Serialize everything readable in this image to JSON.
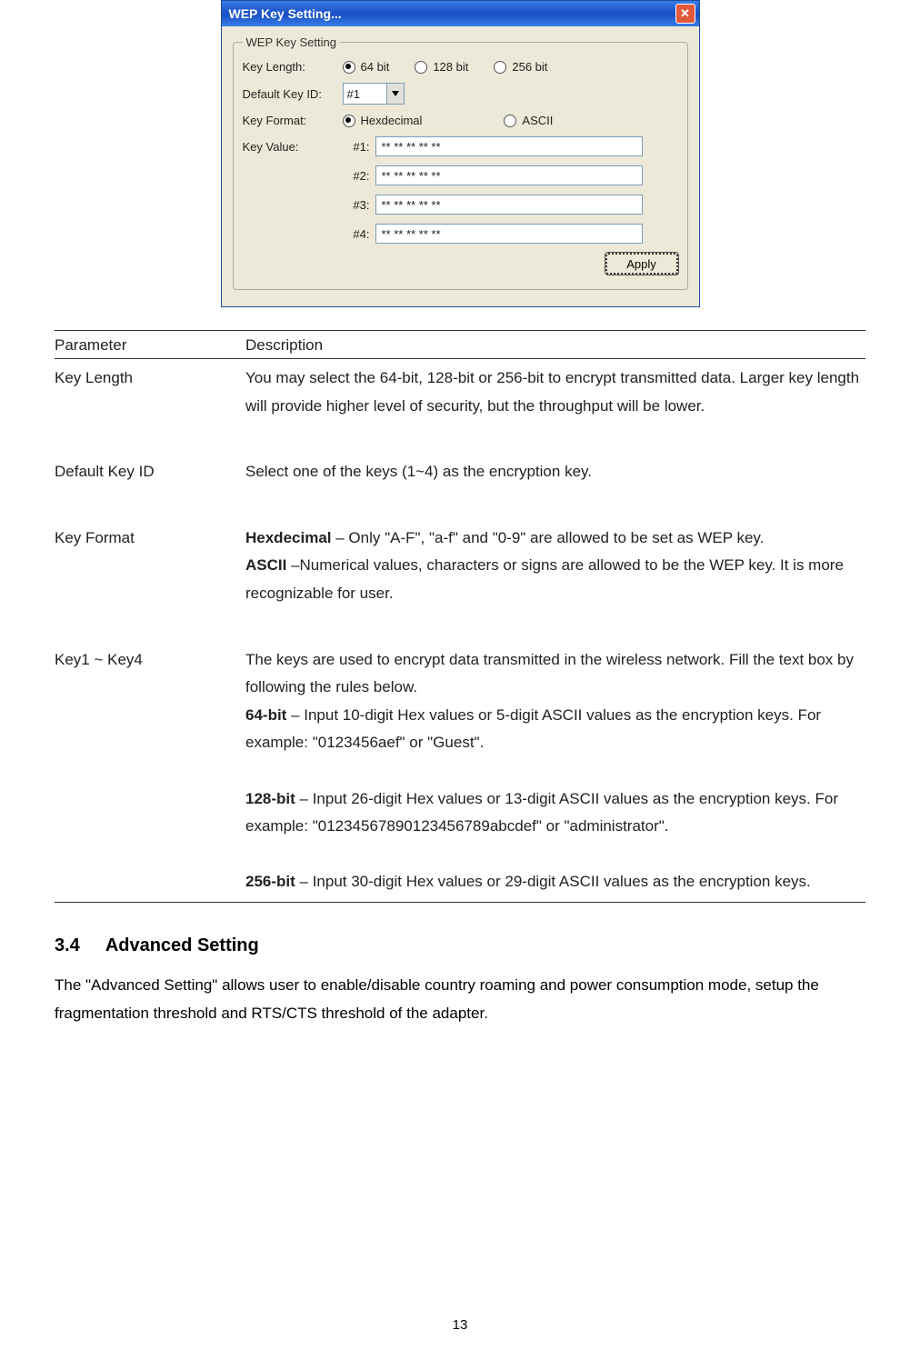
{
  "dialog": {
    "title": "WEP Key Setting...",
    "legend": "WEP Key Setting",
    "rows": {
      "keyLength": {
        "label": "Key Length:",
        "options": [
          "64 bit",
          "128 bit",
          "256 bit"
        ]
      },
      "defaultKeyId": {
        "label": "Default Key ID:",
        "value": "#1"
      },
      "keyFormat": {
        "label": "Key Format:",
        "options": [
          "Hexdecimal",
          "ASCII"
        ]
      },
      "keyValue": {
        "label": "Key Value:",
        "keys": [
          {
            "idx": "#1:",
            "val": "** ** ** ** **"
          },
          {
            "idx": "#2:",
            "val": "** ** ** ** **"
          },
          {
            "idx": "#3:",
            "val": "** ** ** ** **"
          },
          {
            "idx": "#4:",
            "val": "** ** ** ** **"
          }
        ]
      },
      "apply": "Apply"
    }
  },
  "table": {
    "head": {
      "param": "Parameter",
      "desc": "Description"
    },
    "keyLength": {
      "param": "Key Length",
      "desc": "You may select the 64-bit, 128-bit or 256-bit to encrypt transmitted data. Larger key length will provide higher level of security, but the throughput will be lower."
    },
    "defaultKeyId": {
      "param": "Default Key ID",
      "desc": "Select one of the keys (1~4) as the encryption key."
    },
    "keyFormat": {
      "param": "Key Format",
      "hex_bold": "Hexdecimal",
      "hex": " – Only \"A-F\", \"a-f\" and \"0-9\" are allowed to be set as WEP key.",
      "ascii_bold": "ASCII",
      "ascii": " –Numerical values, characters or signs are allowed to be the WEP key. It is more recognizable for user."
    },
    "key14": {
      "param": "Key1 ~ Key4",
      "intro": "The keys are used to encrypt data transmitted in the wireless network. Fill the text box by following the rules below.",
      "b64_bold": "64-bit",
      "b64": " – Input 10-digit Hex values or 5-digit ASCII values as the encryption keys. For example: \"0123456aef\" or \"Guest\".",
      "b128_bold": "128-bit",
      "b128": " – Input 26-digit Hex values or 13-digit ASCII values as the encryption keys. For example: \"01234567890123456789abcdef\" or \"administrator\".",
      "b256_bold": "256-bit",
      "b256": " – Input 30-digit Hex values or 29-digit ASCII values as the encryption keys."
    }
  },
  "section": {
    "num": "3.4",
    "title": "Advanced Setting",
    "para": "The \"Advanced Setting\" allows user to enable/disable country roaming and power consumption mode, setup the fragmentation threshold and RTS/CTS threshold of the adapter."
  },
  "pageNum": "13"
}
